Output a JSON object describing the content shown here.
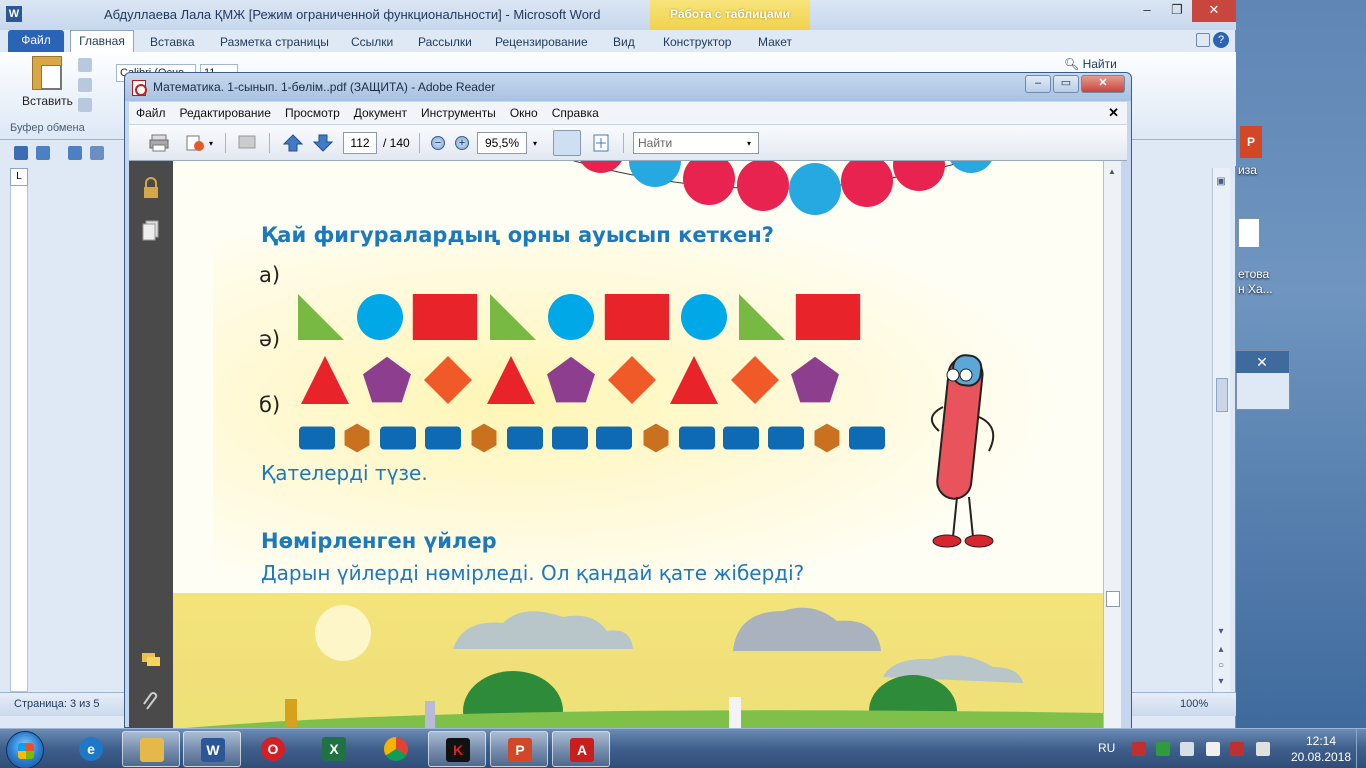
{
  "word": {
    "title": "Абдуллаева Лала ҚМЖ [Режим ограниченной функциональности]  -  Microsoft Word",
    "context_tab_header": "Работа с таблицами",
    "tabs": [
      "Файл",
      "Главная",
      "Вставка",
      "Разметка страницы",
      "Ссылки",
      "Рассылки",
      "Рецензирование",
      "Вид",
      "Конструктор",
      "Макет"
    ],
    "font_name": "Calibri (Осно",
    "font_size": "11",
    "paste_label": "Вставить",
    "clipboard_group": "Буфер обмена",
    "find_label": "Найти",
    "status_page": "Страница: 3 из 5",
    "zoom": "100%"
  },
  "desktop": {
    "labels": [
      "иза",
      "етова",
      "н Ха..."
    ]
  },
  "reader": {
    "title": "Математика. 1-сынып. 1-бөлім..pdf (ЗАЩИТА) - Adobe Reader",
    "menu": [
      "Файл",
      "Редактирование",
      "Просмотр",
      "Документ",
      "Инструменты",
      "Окно",
      "Справка"
    ],
    "page_current": "112",
    "page_total": "/ 140",
    "zoom": "95,5%",
    "find_placeholder": "Найти"
  },
  "page": {
    "question": "Қай фигуралардың орны ауысып кеткен?",
    "labels": [
      "а)",
      "ә)",
      "б)"
    ],
    "fix_instruction": "Қателерді түзе.",
    "subtitle": "Нөмірленген үйлер",
    "subtext": "Дарын үйлерді нөмірледі. Ол қандай қате жіберді?"
  },
  "shapes": {
    "row_a": [
      "triangle-green",
      "circle-blue",
      "square-red",
      "triangle-green",
      "circle-blue",
      "square-red",
      "circle-blue",
      "triangle-green",
      "square-red"
    ],
    "row_ae": [
      "triangle-red",
      "pentagon-purple",
      "diamond-orange",
      "triangle-red",
      "pentagon-purple",
      "diamond-orange",
      "triangle-red",
      "diamond-orange",
      "pentagon-purple"
    ],
    "row_b": [
      "rect-blue",
      "hexagon-brown",
      "rect-blue",
      "rect-blue",
      "hexagon-brown",
      "rect-blue",
      "rect-blue",
      "rect-blue",
      "hexagon-brown",
      "rect-blue",
      "rect-blue",
      "rect-blue",
      "hexagon-brown",
      "rect-blue"
    ],
    "colors": {
      "green": "#77b943",
      "blue": "#00a8e8",
      "red": "#e8232a",
      "purple": "#8d3e8f",
      "orange": "#f05a28",
      "brown": "#c9711e",
      "navy": "#0f6ab4"
    }
  },
  "taskbar": {
    "apps": [
      "explorer-app",
      "ie-app",
      "library-app",
      "word-app",
      "opera-app",
      "excel-app",
      "chrome-app",
      "kaspersky-app",
      "powerpoint-app",
      "acrobat-app"
    ],
    "lang": "RU",
    "time": "12:14",
    "date": "20.08.2018"
  }
}
